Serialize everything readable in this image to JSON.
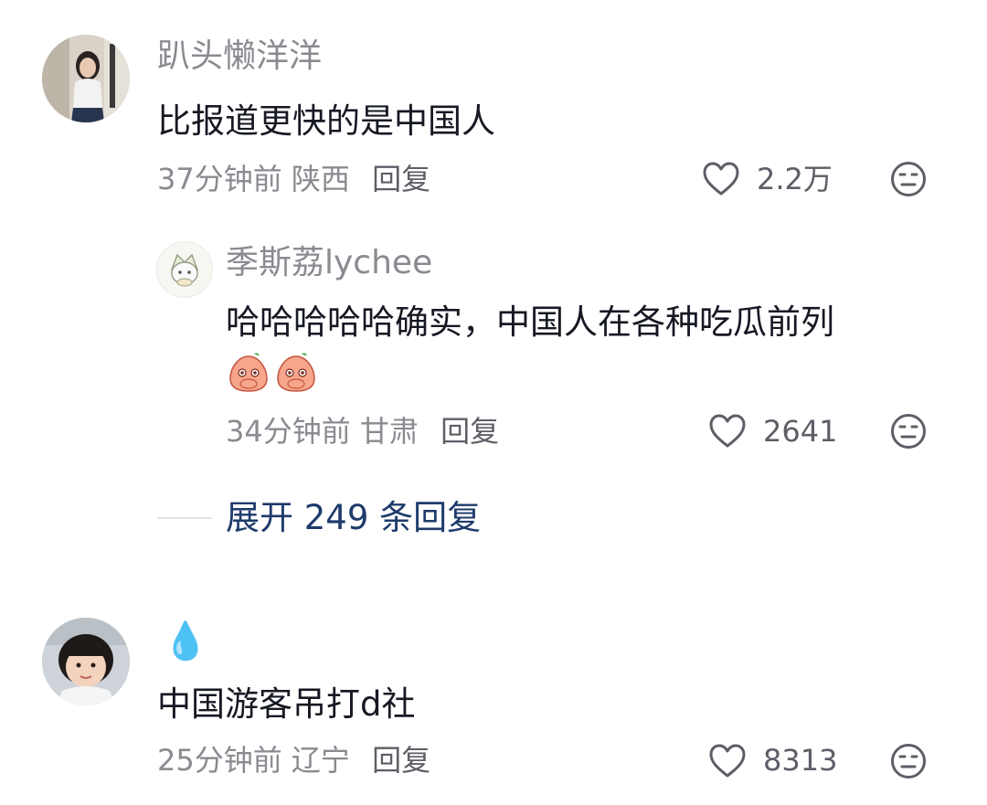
{
  "comments": [
    {
      "username": "趴头懒洋洋",
      "text": "比报道更快的是中国人",
      "time": "37分钟前",
      "location": "陕西",
      "reply_label": "回复",
      "likes": "2.2万",
      "replies": [
        {
          "username": "季斯荔lychee",
          "text": "哈哈哈哈哈确实，中国人在各种吃瓜前列",
          "emojis": [
            "peach-cover-mouth-emoji",
            "peach-cover-mouth-emoji"
          ],
          "time": "34分钟前",
          "location": "甘肃",
          "reply_label": "回复",
          "likes": "2641"
        }
      ],
      "expand_label": "展开 249 条回复"
    },
    {
      "username": "💧",
      "text": "中国游客吊打d社",
      "time": "25分钟前",
      "location": "辽宁",
      "reply_label": "回复",
      "likes": "8313"
    }
  ],
  "icons": {
    "like": "heart-outline-icon",
    "dislike": "meh-face-icon"
  },
  "colors": {
    "secondary_text": "#8a8b91",
    "primary_text": "#161823",
    "expand_link": "#1e3a6b",
    "drop_blue": "#3fa9f5"
  }
}
